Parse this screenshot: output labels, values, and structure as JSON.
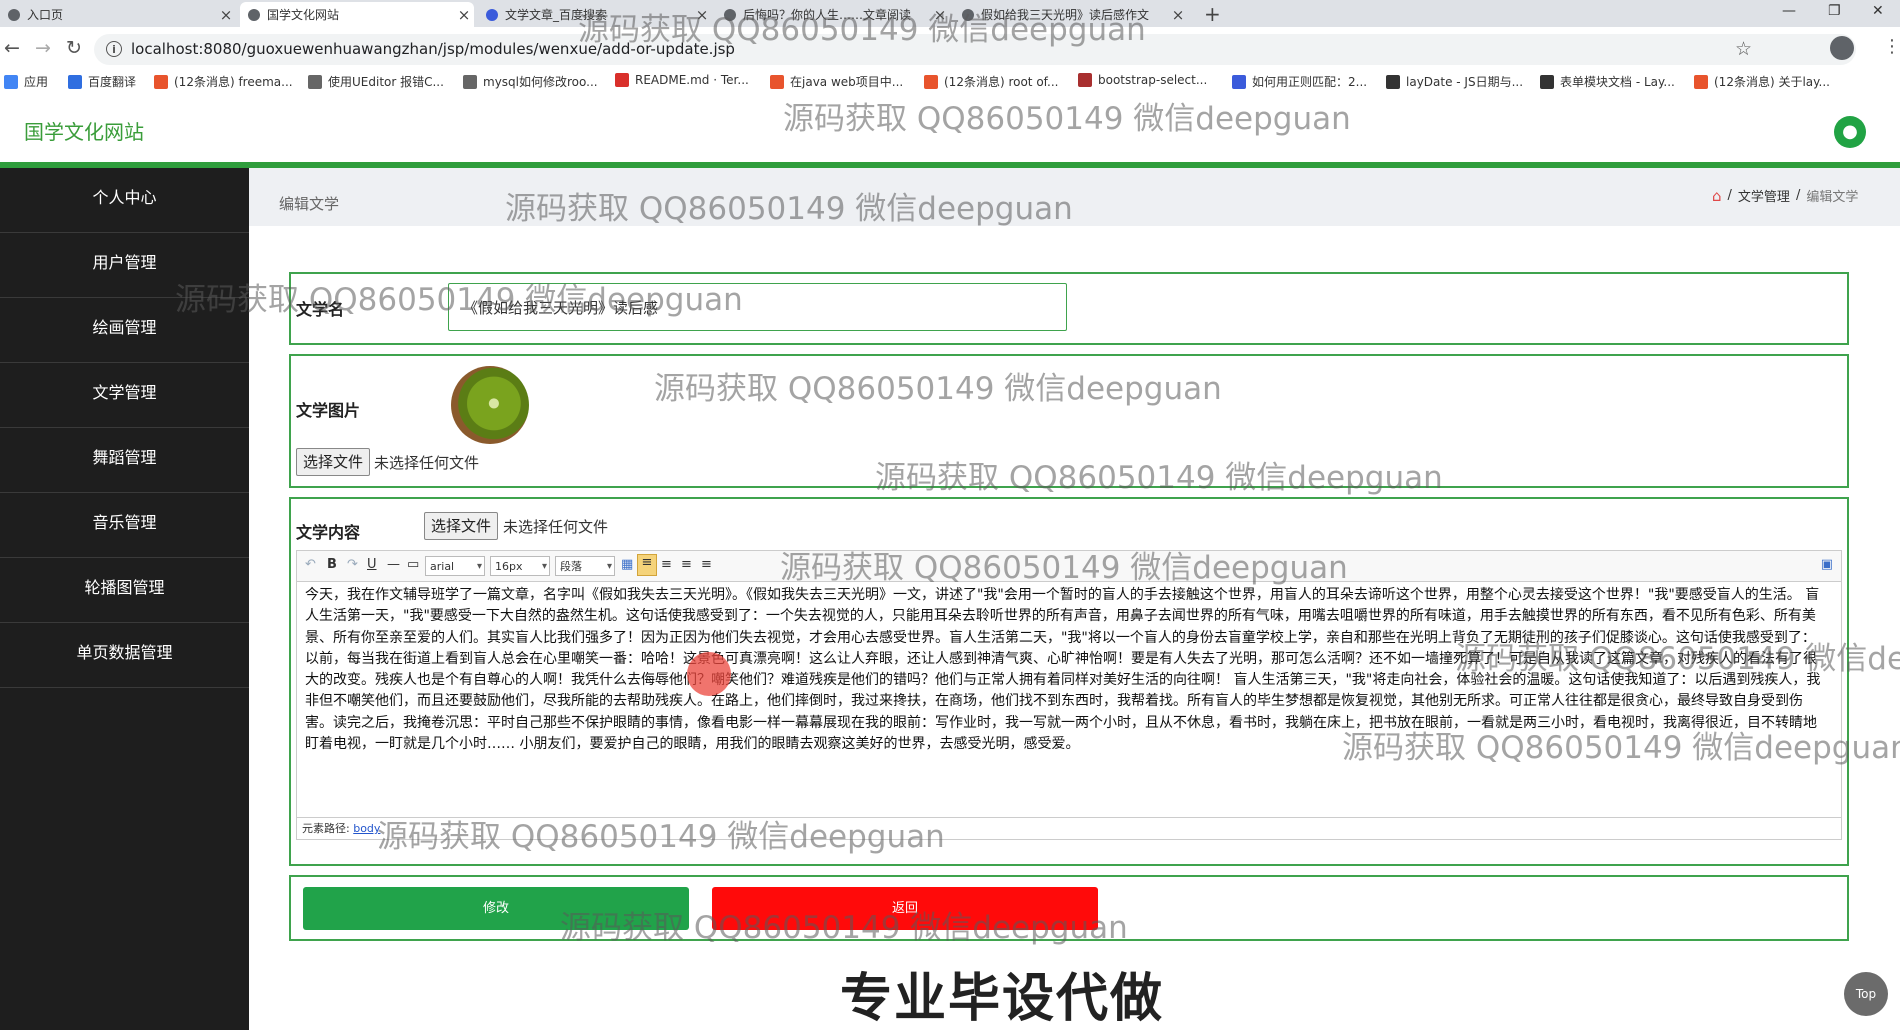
{
  "browser": {
    "tabs": [
      {
        "title": "入口页",
        "active": false
      },
      {
        "title": "国学文化网站",
        "active": true
      },
      {
        "title": "文学文章_百度搜索",
        "active": false
      },
      {
        "title": "后悔吗？你的人生……文章阅读",
        "active": false
      },
      {
        "title": "假如给我三天光明》读后感作文",
        "active": false
      }
    ],
    "new_tab": "+",
    "url": "localhost:8080/guoxuewenhuawangzhan/jsp/modules/wenxue/add-or-update.jsp",
    "bookmarks": [
      {
        "label": "应用",
        "color": "#4285f4"
      },
      {
        "label": "百度翻译",
        "color": "#2f6ee0"
      },
      {
        "label": "(12条消息) freema...",
        "color": "#e8542d"
      },
      {
        "label": "使用UEditor 报错C...",
        "color": "#666666"
      },
      {
        "label": "mysql如何修改roo...",
        "color": "#666666"
      },
      {
        "label": "README.md · Ter...",
        "color": "#d9302b"
      },
      {
        "label": "在java web项目中...",
        "color": "#e8542d"
      },
      {
        "label": "(12条消息) root of...",
        "color": "#e8542d"
      },
      {
        "label": "bootstrap-select...",
        "color": "#a82f2f"
      },
      {
        "label": "如何用正则匹配：2...",
        "color": "#3b5bdb"
      },
      {
        "label": "layDate - JS日期与...",
        "color": "#333333"
      },
      {
        "label": "表单模块文档 - Lay...",
        "color": "#333333"
      },
      {
        "label": "(12条消息) 关于lay...",
        "color": "#e8542d"
      }
    ]
  },
  "app": {
    "brand": "国学文化网站",
    "accent": "#2f9d3c",
    "sidebar": [
      "个人中心",
      "用户管理",
      "绘画管理",
      "文学管理",
      "舞蹈管理",
      "音乐管理",
      "轮播图管理",
      "单页数据管理"
    ],
    "page_title": "编辑文学",
    "breadcrumb": {
      "section": "文学管理",
      "current": "编辑文学",
      "sep": "/"
    }
  },
  "form": {
    "name_label": "文学名",
    "name_value": "《假如给我三天光明》读后感",
    "image_label": "文学图片",
    "file_button": "选择文件",
    "no_file": "未选择任何文件",
    "content_label": "文学内容",
    "editor": {
      "font": "arial",
      "size": "16px",
      "paragraph": "段落",
      "path_label": "元素路径:",
      "path_link": "body",
      "text": "今天，我在作文辅导班学了一篇文章，名字叫《假如我失去三天光明》。《假如我失去三天光明》一文，讲述了\"我\"会用一个暂时的盲人的手去接触这个世界，用盲人的耳朵去谛听这个世界，用整个心灵去接受这个世界！\"我\"要感受盲人的生活。 盲人生活第一天，\"我\"要感受一下大自然的盎然生机。这句话使我感受到了：一个失去视觉的人，只能用耳朵去聆听世界的所有声音，用鼻子去闻世界的所有气味，用嘴去咀嚼世界的所有味道，用手去触摸世界的所有东西，看不见所有色彩、所有美景、所有你至亲至爱的人们。其实盲人比我们强多了！因为正因为他们失去视觉，才会用心去感受世界。盲人生活第二天，\"我\"将以一个盲人的身份去盲童学校上学，亲自和那些在光明上背负了无期徒刑的孩子们促膝谈心。这句话使我感受到了：以前，每当我在街道上看到盲人总会在心里嘲笑一番：哈哈！这景色可真漂亮啊！这么让人弃眼，还让人感到神清气爽、心旷神怡啊！要是有人失去了光明，那可怎么活啊？还不如一墙撞死算了！可是自从我读了这篇文章，对残疾人的看法有了很大的改变。残疾人也是个有自尊心的人啊！我凭什么去侮辱他们？嘲笑他们？难道残疾是他们的错吗？他们与正常人拥有着同样对美好生活的向往啊！ 盲人生活第三天，\"我\"将走向社会，体验社会的温暖。这句话使我知道了：以后遇到残疾人，我非但不嘲笑他们，而且还要鼓励他们，尽我所能的去帮助残疾人。在路上，他们摔倒时，我过来搀扶，在商场，他们找不到东西时，我帮着找。所有盲人的毕生梦想都是恢复视觉，其他别无所求。可正常人往往都是很贪心，最终导致自身受到伤害。读完之后，我掩卷沉思：平时自己那些不保护眼睛的事情，像看电影一样一幕幕展现在我的眼前：写作业时，我一写就一两个小时，且从不休息，看书时，我躺在床上，把书放在眼前，一看就是两三小时，看电视时，我离得很近，目不转睛地盯着电视，一盯就是几个小时…… 小朋友们，要爱护自己的眼睛，用我们的眼睛去观察这美好的世界，去感受光明，感受爱。"
    },
    "submit": {
      "label": "修改",
      "color": "#21a34a"
    },
    "back": {
      "label": "返回",
      "color": "#ff0a0a"
    }
  },
  "overlay": {
    "watermark": "源码获取 QQ86050149 微信deepguan",
    "promo": "专业毕设代做",
    "top_button": "Top"
  }
}
